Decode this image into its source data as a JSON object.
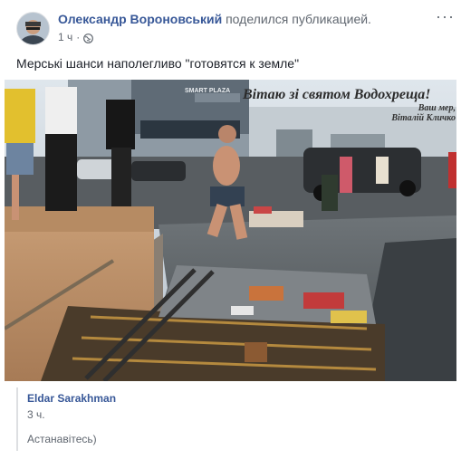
{
  "post": {
    "author": "Олександр Вороновський",
    "action": "поделился публикацией.",
    "time": "1 ч",
    "privacy_icon": "globe-icon",
    "more_icon": "more-options-icon",
    "more_label": "···",
    "text": "Мерські шанси наполегливо \"готовятся к земле\""
  },
  "photo": {
    "overlay_title": "Вітаю зі святом Водохреща!",
    "overlay_sign_line1": "Ваш мер,",
    "overlay_sign_line2": "Віталій Кличко",
    "storefront_sign": "SMART PLAZA"
  },
  "shared": {
    "author": "Eldar Sarakhman",
    "time": "3 ч.",
    "text": "Астанавітесь)"
  }
}
